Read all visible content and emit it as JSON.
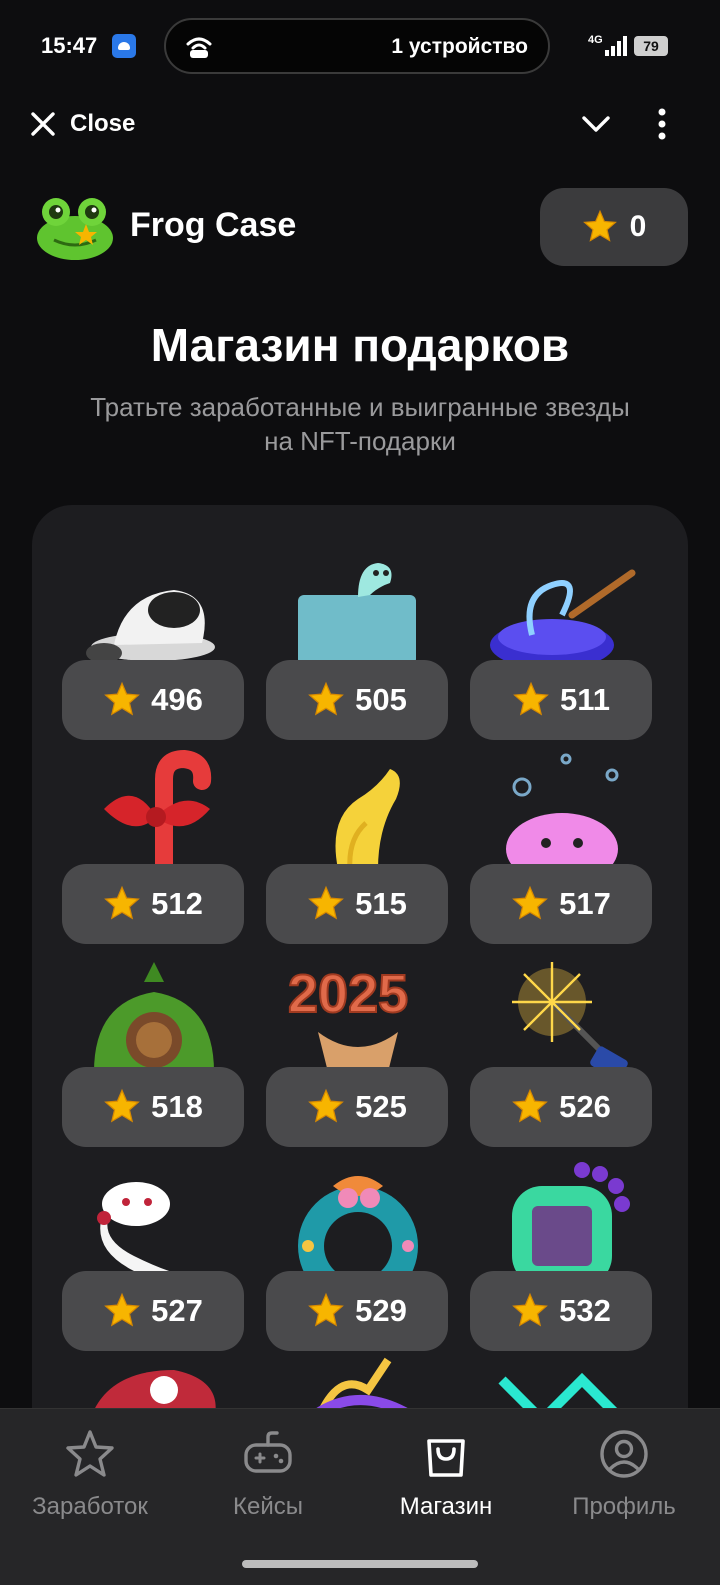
{
  "status_bar": {
    "time": "15:47",
    "island_text": "1 устройство",
    "network": "4G",
    "battery": "79"
  },
  "header": {
    "close_label": "Close"
  },
  "app": {
    "title": "Frog Case",
    "balance": "0"
  },
  "page": {
    "title": "Магазин подарков",
    "subtitle": "Тратьте заработанные и выигранные звезды на NFT-подарки"
  },
  "gifts": [
    {
      "price": "496",
      "icon": "mushroom-gift-icon"
    },
    {
      "price": "505",
      "icon": "aquarium-snake-gift-icon"
    },
    {
      "price": "511",
      "icon": "magic-cauldron-gift-icon"
    },
    {
      "price": "512",
      "icon": "candy-cane-bow-gift-icon"
    },
    {
      "price": "515",
      "icon": "banana-gift-icon"
    },
    {
      "price": "517",
      "icon": "pink-octopus-gift-icon"
    },
    {
      "price": "518",
      "icon": "hobbit-house-gift-icon"
    },
    {
      "price": "525",
      "icon": "cake-2025-gift-icon"
    },
    {
      "price": "526",
      "icon": "sparkler-gift-icon"
    },
    {
      "price": "527",
      "icon": "white-snake-gift-icon"
    },
    {
      "price": "529",
      "icon": "christmas-wreath-gift-icon"
    },
    {
      "price": "532",
      "icon": "green-gadget-gift-icon"
    }
  ],
  "nav": [
    {
      "label": "Заработок",
      "icon": "star-outline-icon",
      "active": false
    },
    {
      "label": "Кейсы",
      "icon": "gamepad-icon",
      "active": false
    },
    {
      "label": "Магазин",
      "icon": "shopping-bag-icon",
      "active": true
    },
    {
      "label": "Профиль",
      "icon": "user-circle-icon",
      "active": false
    }
  ],
  "colors": {
    "background": "#0d0d0f",
    "card": "#1d1d20",
    "button": "#4a4a4c",
    "star": "#f7b500",
    "muted_text": "#9a9a9c"
  }
}
